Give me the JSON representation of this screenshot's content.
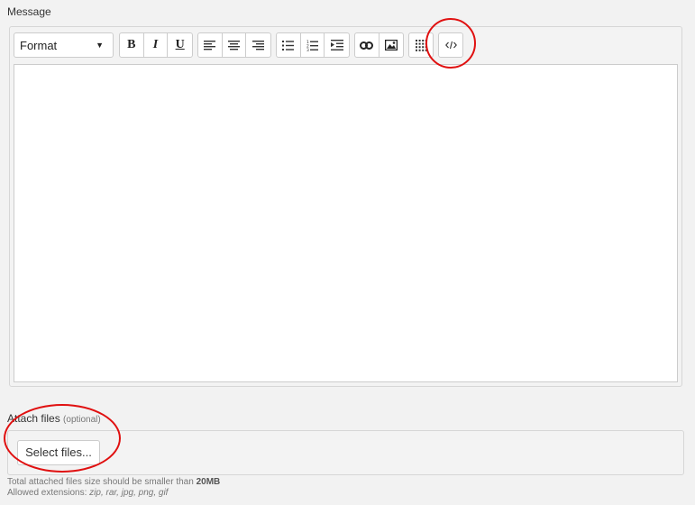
{
  "message_label": "Message",
  "toolbar": {
    "format_label": "Format",
    "format_caret": "▼",
    "bold": "B",
    "italic": "I",
    "underline": "U"
  },
  "attach": {
    "label": "Attach files",
    "optional": "(optional)",
    "select_button": "Select files...",
    "size_note_prefix": "Total attached files size should be smaller than",
    "size_limit": "20MB",
    "extensions_prefix": "Allowed extensions:",
    "extensions": "zip, rar, jpg, png, gif"
  },
  "highlight_color": "#e01010"
}
